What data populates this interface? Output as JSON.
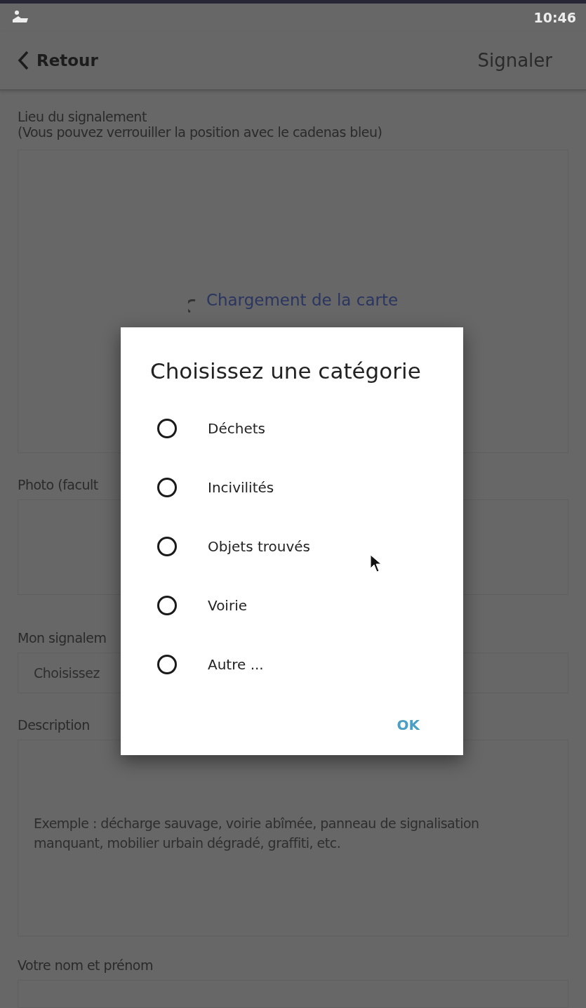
{
  "status_bar": {
    "time": "10:46"
  },
  "header": {
    "back": "Retour",
    "action": "Signaler"
  },
  "location": {
    "label": "Lieu du signalement",
    "hint": "(Vous pouvez verrouiller la position avec le cadenas bleu)",
    "loading": "Chargement de la carte"
  },
  "photo": {
    "label": "Photo (facult"
  },
  "report": {
    "label": "Mon signalem",
    "placeholder": "Choisissez"
  },
  "description": {
    "label": "Description",
    "placeholder": "Exemple : décharge sauvage, voirie abîmée, panneau de signalisation manquant, mobilier urbain dégradé, graffiti, etc."
  },
  "name": {
    "label": "Votre nom et prénom"
  },
  "dialog": {
    "title": "Choisissez une catégorie",
    "options": [
      {
        "label": "Déchets",
        "selected": false
      },
      {
        "label": "Incivilités",
        "selected": false
      },
      {
        "label": "Objets trouvés",
        "selected": false
      },
      {
        "label": "Voirie",
        "selected": false
      },
      {
        "label": "Autre ...",
        "selected": false
      }
    ],
    "ok": "OK"
  }
}
